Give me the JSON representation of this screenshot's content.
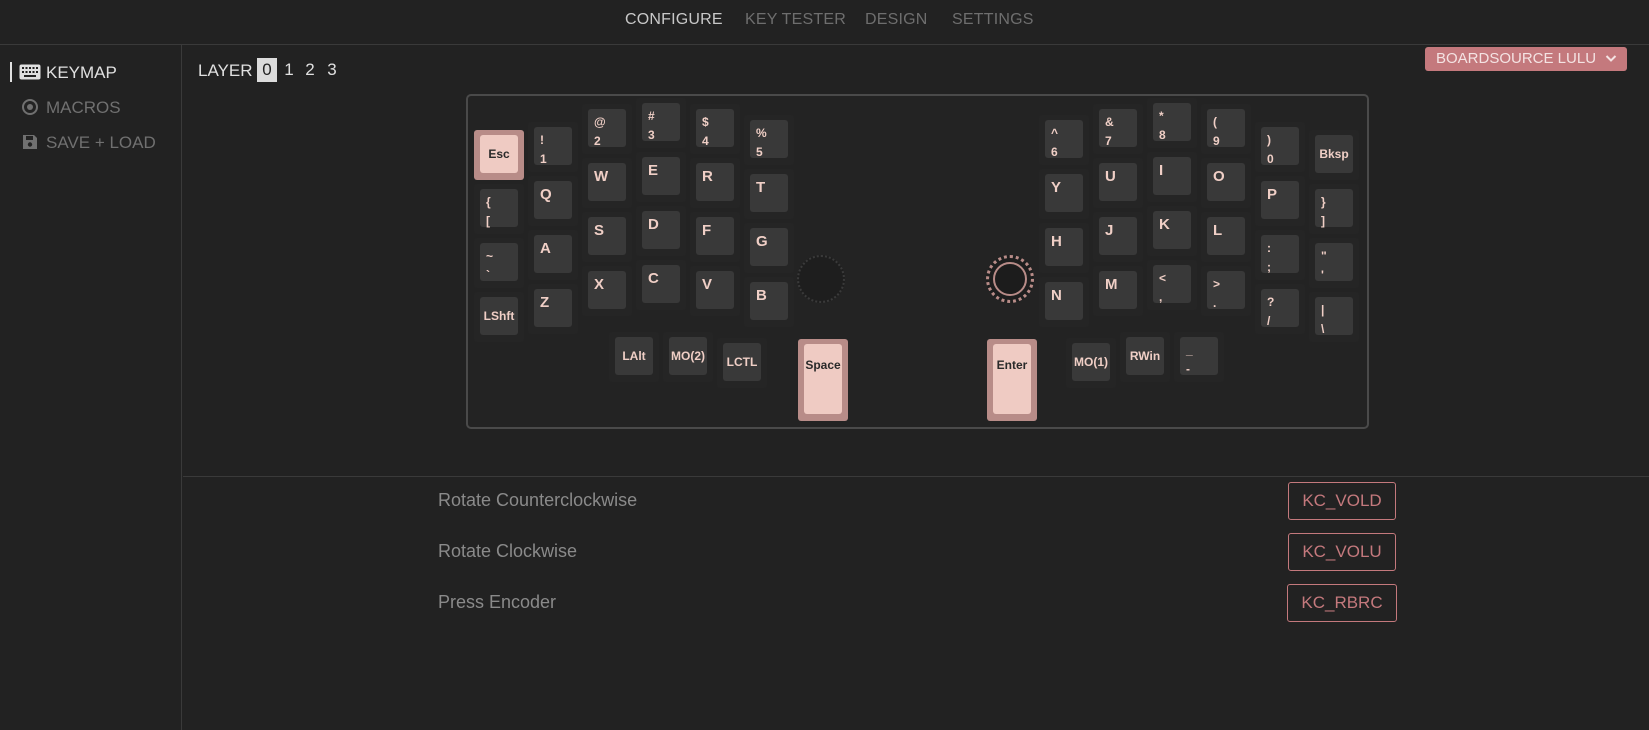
{
  "nav": {
    "tabs": [
      {
        "label": "CONFIGURE",
        "active": true
      },
      {
        "label": "KEY TESTER",
        "active": false
      },
      {
        "label": "DESIGN",
        "active": false
      },
      {
        "label": "SETTINGS",
        "active": false
      }
    ]
  },
  "sidebar": {
    "items": [
      {
        "label": "KEYMAP",
        "icon": "keyboard-icon",
        "active": true
      },
      {
        "label": "MACROS",
        "icon": "record-icon",
        "active": false
      },
      {
        "label": "SAVE + LOAD",
        "icon": "floppy-disk-icon",
        "active": false
      }
    ]
  },
  "layers": {
    "label": "LAYER",
    "options": [
      "0",
      "1",
      "2",
      "3"
    ],
    "selected": "0"
  },
  "board_select": {
    "value": "BOARDSOURCE LULU"
  },
  "keyboard": {
    "left": {
      "esc": "Esc",
      "k1": "!\n1",
      "k2": "@\n2",
      "k3": "#\n3",
      "k4": "$\n4",
      "k5": "%\n5",
      "lbrc": "{\n[",
      "q": "Q",
      "w": "W",
      "e": "E",
      "r": "R",
      "t": "T",
      "grv": "~\n`",
      "a": "A",
      "s": "S",
      "d": "D",
      "f": "F",
      "g": "G",
      "lshft": "LShft",
      "z": "Z",
      "x": "X",
      "c": "C",
      "v": "V",
      "b": "B",
      "lalt": "LAlt",
      "mo2": "MO(2)",
      "lctl": "LCTL",
      "space": "Space"
    },
    "right": {
      "k6": "^\n6",
      "k7": "&\n7",
      "k8": "*\n8",
      "k9": "(\n9",
      "k0": ")\n0",
      "bksp": "Bksp",
      "y": "Y",
      "u": "U",
      "i": "I",
      "o": "O",
      "p": "P",
      "rbrc": "}\n]",
      "h": "H",
      "j": "J",
      "k": "K",
      "l": "L",
      "scln": ":\n;",
      "quot": "\"\n'",
      "n": "N",
      "m": "M",
      "comm": "<\n,",
      "dot": ">\n.",
      "slsh": "?\n/",
      "bsls": "|\n\\",
      "enter": "Enter",
      "mo1": "MO(1)",
      "rwin": "RWin",
      "mins": "_\n-"
    }
  },
  "encoder": {
    "rows": [
      {
        "label": "Rotate Counterclockwise",
        "value": "KC_VOLD"
      },
      {
        "label": "Rotate Clockwise",
        "value": "KC_VOLU"
      },
      {
        "label": "Press Encoder",
        "value": "KC_RBRC"
      }
    ]
  },
  "colors": {
    "accent": "#c4797d",
    "key_accent": "#efcbc3",
    "background": "#222222"
  }
}
